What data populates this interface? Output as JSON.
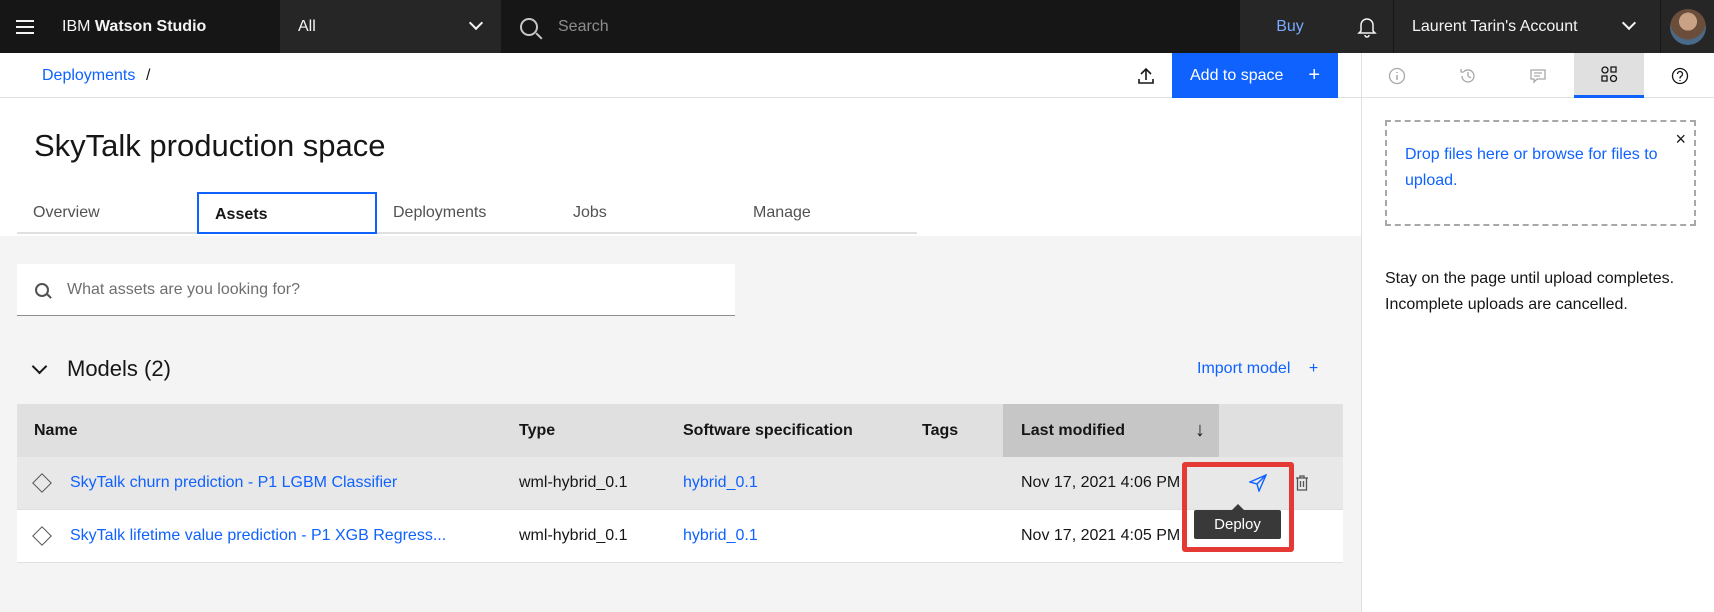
{
  "header": {
    "brand_prefix": "IBM",
    "brand_name": "Watson Studio",
    "scope": "All",
    "search_placeholder": "Search",
    "buy": "Buy",
    "account": "Laurent Tarin's Account"
  },
  "breadcrumb": {
    "item": "Deployments",
    "sep": "/",
    "add_to_space": "Add to space",
    "add_plus": "+"
  },
  "page": {
    "title": "SkyTalk production space",
    "tabs": [
      "Overview",
      "Assets",
      "Deployments",
      "Jobs",
      "Manage"
    ],
    "active_tab": "Assets",
    "assets_search_placeholder": "What assets are you looking for?"
  },
  "models": {
    "heading": "Models (2)",
    "import_label": "Import model",
    "import_plus": "+",
    "columns": {
      "name": "Name",
      "type": "Type",
      "software": "Software specification",
      "tags": "Tags",
      "modified": "Last modified",
      "sort_icon": "↓"
    },
    "rows": [
      {
        "name": "SkyTalk churn prediction - P1 LGBM Classifier",
        "type": "wml-hybrid_0.1",
        "software": "hybrid_0.1",
        "tags": "",
        "modified": "Nov 17, 2021 4:06 PM"
      },
      {
        "name": "SkyTalk lifetime value prediction - P1 XGB Regress...",
        "type": "wml-hybrid_0.1",
        "software": "hybrid_0.1",
        "tags": "",
        "modified": "Nov 17, 2021 4:05 PM"
      }
    ],
    "tooltip": "Deploy"
  },
  "panel": {
    "dropzone": "Drop files here or browse for files to upload.",
    "close": "×",
    "note": "Stay on the page until upload completes. Incomplete uploads are cancelled."
  },
  "colors": {
    "accent": "#0f62fe",
    "highlight": "#e53935"
  }
}
